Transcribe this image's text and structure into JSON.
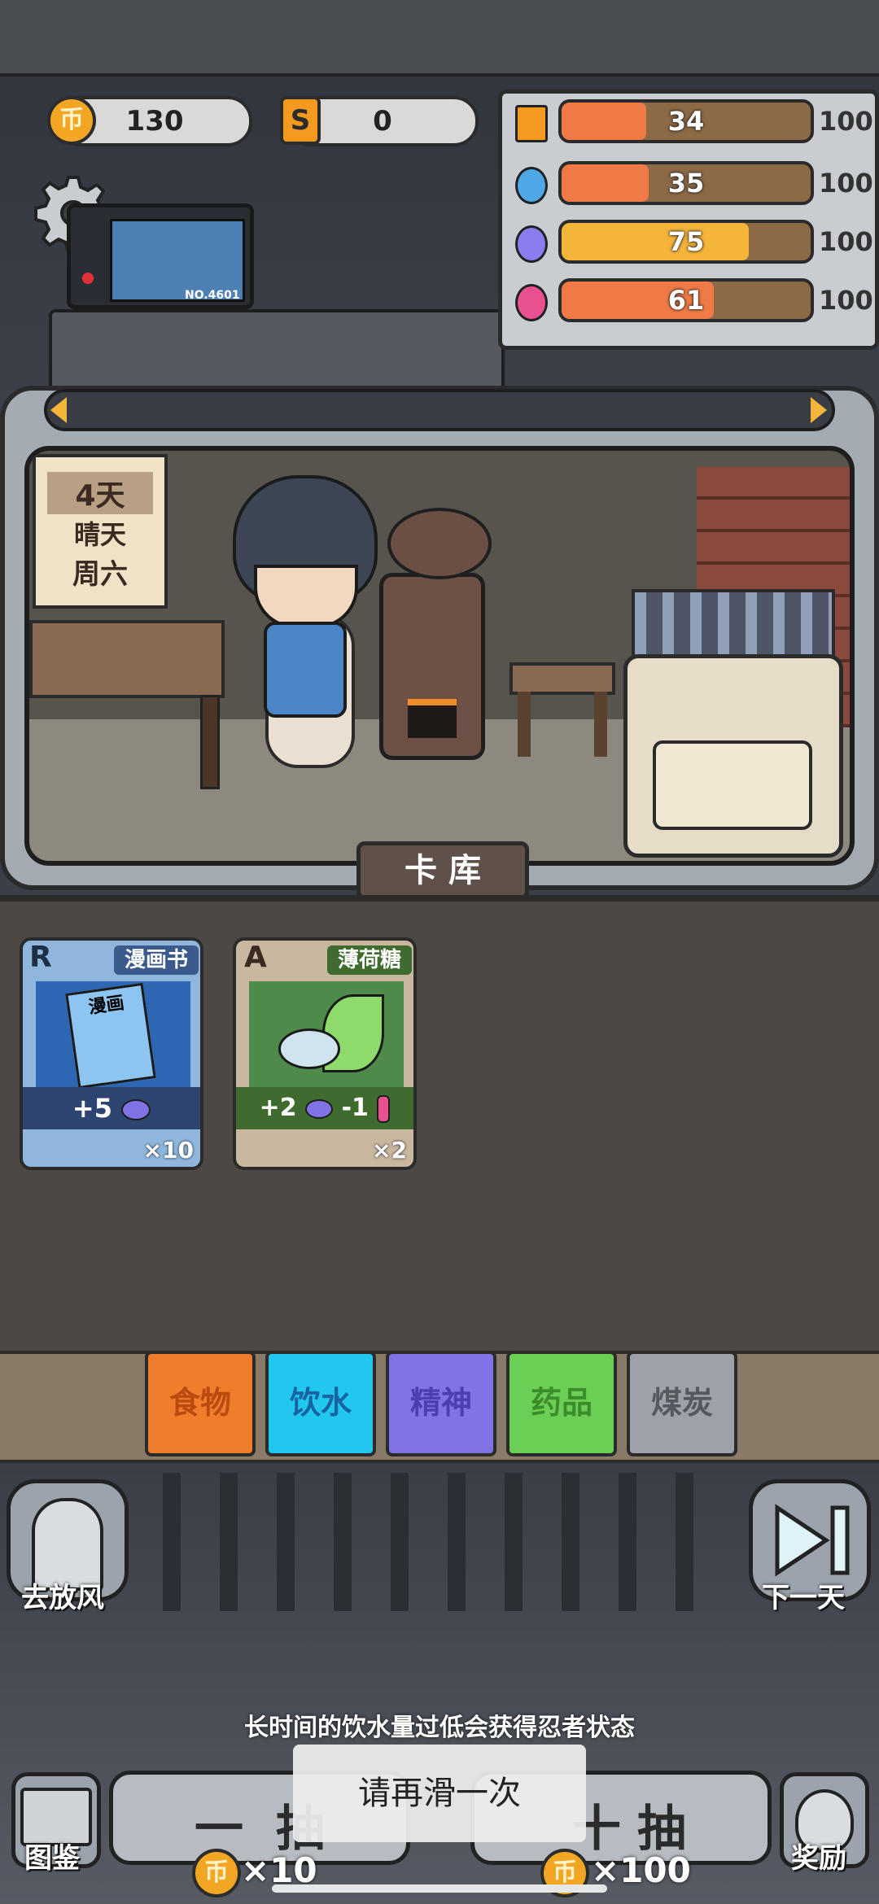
{
  "currency": {
    "coins": "130",
    "special": "0",
    "coin_symbol": "币",
    "special_symbol": "S"
  },
  "stats": [
    {
      "name": "energy-icon",
      "value": "34",
      "max": "100",
      "fill": 0.34,
      "color": "#f07a45"
    },
    {
      "name": "water-drop-icon",
      "value": "35",
      "max": "100",
      "fill": 0.35,
      "color": "#f07a45"
    },
    {
      "name": "brain-icon",
      "value": "75",
      "max": "100",
      "fill": 0.75,
      "color": "#f5b43a"
    },
    {
      "name": "thermometer-icon",
      "value": "61",
      "max": "100",
      "fill": 0.61,
      "color": "#f07a45"
    }
  ],
  "monitor_label": "NO.4601",
  "calendar": {
    "day": "4天",
    "weather": "晴天",
    "weekday": "周六"
  },
  "deck_title": "卡 库",
  "cards": [
    {
      "rank": "R",
      "name": "漫画书",
      "art_text": "漫画",
      "effect": "+5",
      "count": "×10",
      "color": "#3a5a8c"
    },
    {
      "rank": "A",
      "name": "薄荷糖",
      "effect": "+2",
      "effect2": "-1",
      "count": "×2",
      "color": "#3f6b2f"
    }
  ],
  "categories": [
    {
      "label": "食物",
      "bg": "#f07d2b",
      "fg": "#b94a10"
    },
    {
      "label": "饮水",
      "bg": "#21c7ef",
      "fg": "#1664a0"
    },
    {
      "label": "精神",
      "bg": "#7f73e6",
      "fg": "#4a3fb0"
    },
    {
      "label": "药品",
      "bg": "#6ccf55",
      "fg": "#3b8c2a"
    },
    {
      "label": "煤炭",
      "bg": "#9ea1a8",
      "fg": "#55585e"
    }
  ],
  "actions": {
    "go_out": "去放风",
    "next_day": "下一天",
    "guide": "图鉴",
    "reward": "奖励"
  },
  "tip": "长时间的饮水量过低会获得忍者状态",
  "draw": {
    "single_label_left": "一",
    "single_label_right": "抽",
    "single_cost": "×10",
    "ten_label_left": "十",
    "ten_label_right": "抽",
    "ten_cost": "×100"
  },
  "toast": "请再滑一次"
}
